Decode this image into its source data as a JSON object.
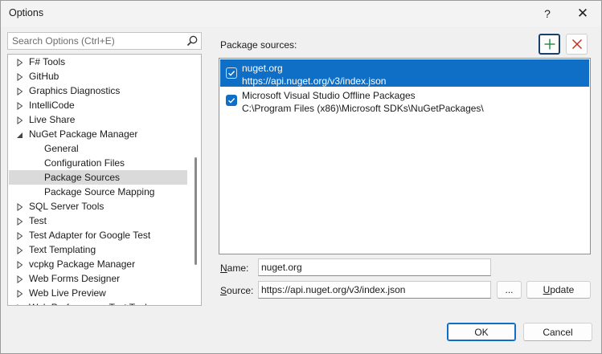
{
  "window": {
    "title": "Options",
    "help": "?",
    "close": "✕"
  },
  "search": {
    "placeholder": "Search Options (Ctrl+E)"
  },
  "tree": [
    {
      "label": "F# Tools",
      "expander": "collapsed",
      "level": 0
    },
    {
      "label": "GitHub",
      "expander": "collapsed",
      "level": 0
    },
    {
      "label": "Graphics Diagnostics",
      "expander": "collapsed",
      "level": 0
    },
    {
      "label": "IntelliCode",
      "expander": "collapsed",
      "level": 0
    },
    {
      "label": "Live Share",
      "expander": "collapsed",
      "level": 0
    },
    {
      "label": "NuGet Package Manager",
      "expander": "expanded",
      "level": 0
    },
    {
      "label": "General",
      "expander": "none",
      "level": 1
    },
    {
      "label": "Configuration Files",
      "expander": "none",
      "level": 1
    },
    {
      "label": "Package Sources",
      "expander": "none",
      "level": 1,
      "selected": true
    },
    {
      "label": "Package Source Mapping",
      "expander": "none",
      "level": 1
    },
    {
      "label": "SQL Server Tools",
      "expander": "collapsed",
      "level": 0
    },
    {
      "label": "Test",
      "expander": "collapsed",
      "level": 0
    },
    {
      "label": "Test Adapter for Google Test",
      "expander": "collapsed",
      "level": 0
    },
    {
      "label": "Text Templating",
      "expander": "collapsed",
      "level": 0
    },
    {
      "label": "vcpkg Package Manager",
      "expander": "collapsed",
      "level": 0
    },
    {
      "label": "Web Forms Designer",
      "expander": "collapsed",
      "level": 0
    },
    {
      "label": "Web Live Preview",
      "expander": "collapsed",
      "level": 0
    },
    {
      "label": "Web Performance Test Tools",
      "expander": "collapsed",
      "level": 0
    }
  ],
  "panel": {
    "sources_label": "Package sources:",
    "sources": [
      {
        "name": "nuget.org",
        "url": "https://api.nuget.org/v3/index.json",
        "checked": true,
        "selected": true
      },
      {
        "name": "Microsoft Visual Studio Offline Packages",
        "url": "C:\\Program Files (x86)\\Microsoft SDKs\\NuGetPackages\\",
        "checked": true,
        "selected": false
      }
    ],
    "name_label_key": "N",
    "name_label_rest": "ame:",
    "name_value": "nuget.org",
    "source_label_key": "S",
    "source_label_rest": "ource:",
    "source_value": "https://api.nuget.org/v3/index.json",
    "browse_label": "...",
    "update_label_key": "U",
    "update_label_rest": "pdate"
  },
  "footer": {
    "ok": "OK",
    "cancel": "Cancel"
  },
  "colors": {
    "accent": "#0f6fc6",
    "add_icon": "#1e8a3a",
    "remove_icon": "#c42b1c"
  }
}
